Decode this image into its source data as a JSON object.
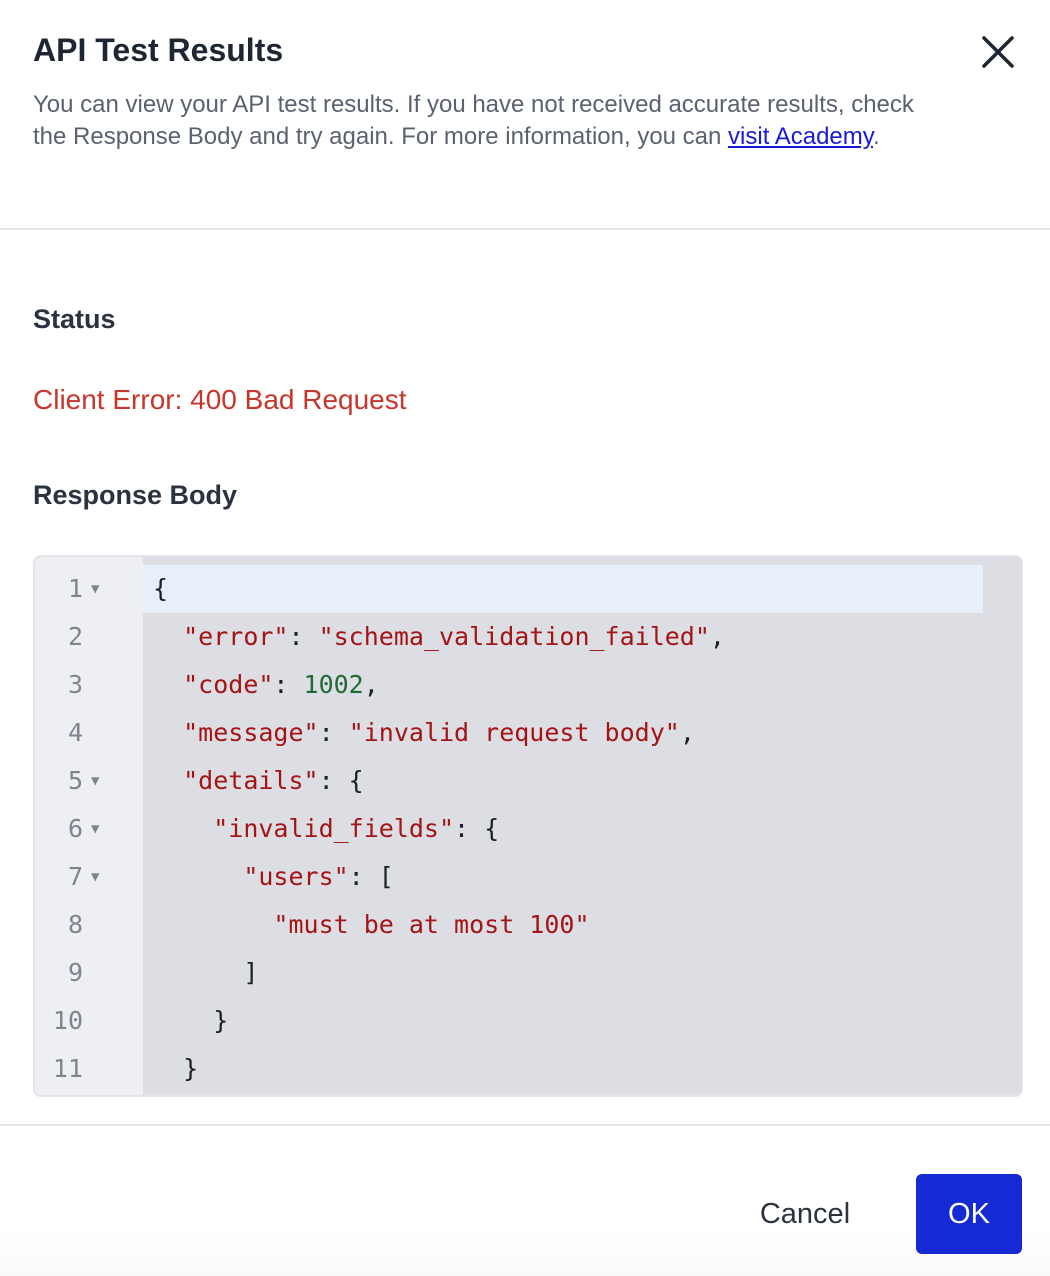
{
  "dialog": {
    "title": "API Test Results",
    "description_text": "You can view your API test results. If you have not received accurate results, check the Response Body and try again. For more information, you can ",
    "description_link": "visit Academy",
    "description_end": "."
  },
  "status": {
    "label": "Status",
    "value": "Client Error: 400 Bad Request"
  },
  "response_body": {
    "label": "Response Body",
    "lines": [
      {
        "n": "1",
        "foldable": true
      },
      {
        "n": "2",
        "foldable": false
      },
      {
        "n": "3",
        "foldable": false
      },
      {
        "n": "4",
        "foldable": false
      },
      {
        "n": "5",
        "foldable": true
      },
      {
        "n": "6",
        "foldable": true
      },
      {
        "n": "7",
        "foldable": true
      },
      {
        "n": "8",
        "foldable": false
      },
      {
        "n": "9",
        "foldable": false
      },
      {
        "n": "10",
        "foldable": false
      },
      {
        "n": "11",
        "foldable": false
      }
    ],
    "code": {
      "l1": "{",
      "l2_key": "\"error\"",
      "l2_val": "\"schema_validation_failed\"",
      "l3_key": "\"code\"",
      "l3_val": "1002",
      "l4_key": "\"message\"",
      "l4_val": "\"invalid request body\"",
      "l5_key": "\"details\"",
      "l6_key": "\"invalid_fields\"",
      "l7_key": "\"users\"",
      "l8_val": "\"must be at most 100\"",
      "l9": "]",
      "l10": "}",
      "l11": "}"
    }
  },
  "footer": {
    "cancel_label": "Cancel",
    "ok_label": "OK"
  },
  "colors": {
    "accent": "#1529d4",
    "error": "#c8352b",
    "link": "#1a1ad6"
  },
  "icons": {
    "close": "close-icon",
    "fold": "fold-arrow-icon"
  }
}
